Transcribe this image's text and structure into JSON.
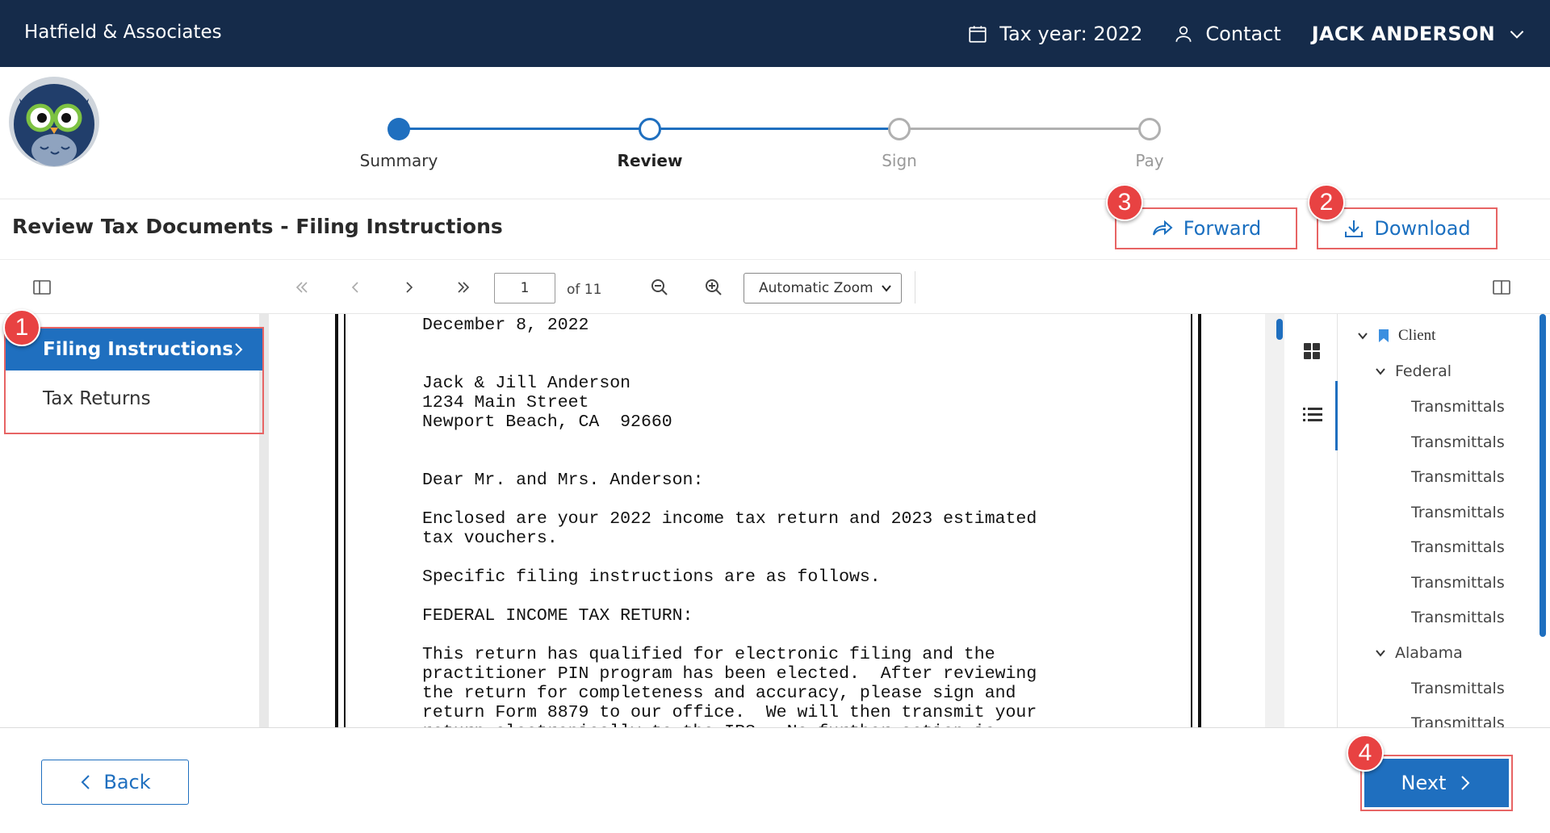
{
  "header": {
    "brand": "Hatfield & Associates",
    "tax_year": "Tax year: 2022",
    "contact": "Contact",
    "user_name": "JACK ANDERSON"
  },
  "stepper": {
    "steps": [
      {
        "label": "Summary",
        "state": "complete"
      },
      {
        "label": "Review",
        "state": "current"
      },
      {
        "label": "Sign",
        "state": "upcoming"
      },
      {
        "label": "Pay",
        "state": "upcoming"
      }
    ]
  },
  "page": {
    "title": "Review Tax Documents - Filing Instructions",
    "forward_label": "Forward",
    "download_label": "Download"
  },
  "callouts": {
    "nav": "1",
    "download": "2",
    "forward": "3",
    "next": "4"
  },
  "viewer": {
    "current_page": "1",
    "page_count_label": "of 11",
    "zoom": "Automatic Zoom"
  },
  "doc_nav": {
    "items": [
      {
        "label": "Filing Instructions",
        "active": true
      },
      {
        "label": "Tax Returns",
        "active": false
      }
    ]
  },
  "document": {
    "lines": [
      "December 8, 2022",
      "",
      "",
      "Jack & Jill Anderson",
      "1234 Main Street",
      "Newport Beach, CA  92660",
      "",
      "",
      "Dear Mr. and Mrs. Anderson:",
      "",
      "Enclosed are your 2022 income tax return and 2023 estimated",
      "tax vouchers.",
      "",
      "Specific filing instructions are as follows.",
      "",
      "FEDERAL INCOME TAX RETURN:",
      "",
      "This return has qualified for electronic filing and the",
      "practitioner PIN program has been elected.  After reviewing",
      "the return for completeness and accuracy, please sign and",
      "return Form 8879 to our office.  We will then transmit your",
      "return electronically to the IRS.  No further action is"
    ]
  },
  "outline": {
    "root": "Client",
    "groups": [
      {
        "label": "Federal",
        "items": [
          "Transmittals",
          "Transmittals",
          "Transmittals",
          "Transmittals",
          "Transmittals",
          "Transmittals",
          "Transmittals"
        ]
      },
      {
        "label": "Alabama",
        "items": [
          "Transmittals",
          "Transmittals"
        ]
      }
    ]
  },
  "footer": {
    "back_label": "Back",
    "next_label": "Next"
  },
  "colors": {
    "topbar": "#152b4a",
    "accent": "#1f6fbf",
    "callout": "#e84242"
  }
}
